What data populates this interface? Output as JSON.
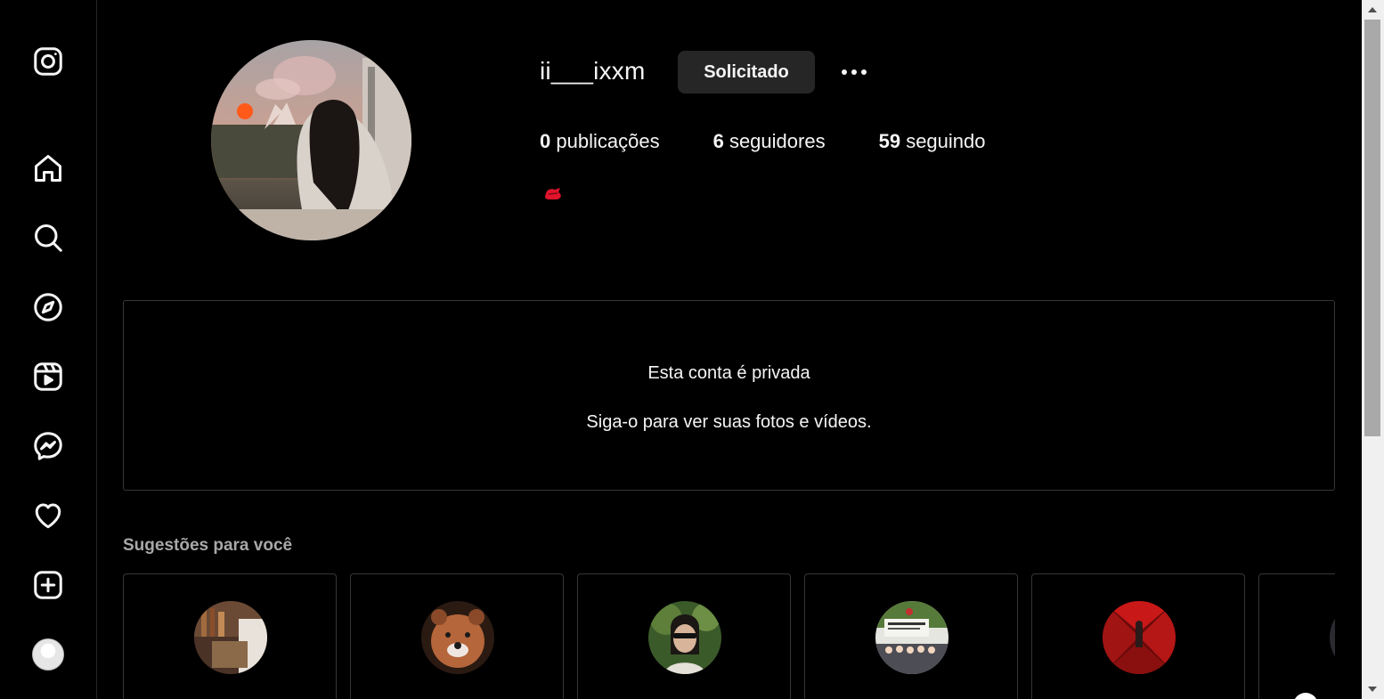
{
  "sidebar": {
    "items": [
      {
        "icon": "instagram-logo-icon"
      },
      {
        "icon": "home-icon"
      },
      {
        "icon": "search-icon"
      },
      {
        "icon": "explore-compass-icon"
      },
      {
        "icon": "reels-icon"
      },
      {
        "icon": "messenger-icon"
      },
      {
        "icon": "heart-icon"
      },
      {
        "icon": "create-plus-icon"
      },
      {
        "icon": "profile-avatar-icon"
      }
    ]
  },
  "profile": {
    "username": "ii___ixxm",
    "follow_button_label": "Solicitado",
    "posts_count": "0",
    "posts_label": "publicações",
    "followers_count": "6",
    "followers_label": "seguidores",
    "following_count": "59",
    "following_label": "seguindo"
  },
  "private_notice": {
    "title": "Esta conta é privada",
    "subtitle": "Siga-o para ver suas fotos e vídeos."
  },
  "suggestions": {
    "title": "Sugestões para você"
  },
  "colors": {
    "background": "#000000",
    "button_bg": "#262626",
    "border": "#363636",
    "muted_text": "#a8a8a8"
  }
}
